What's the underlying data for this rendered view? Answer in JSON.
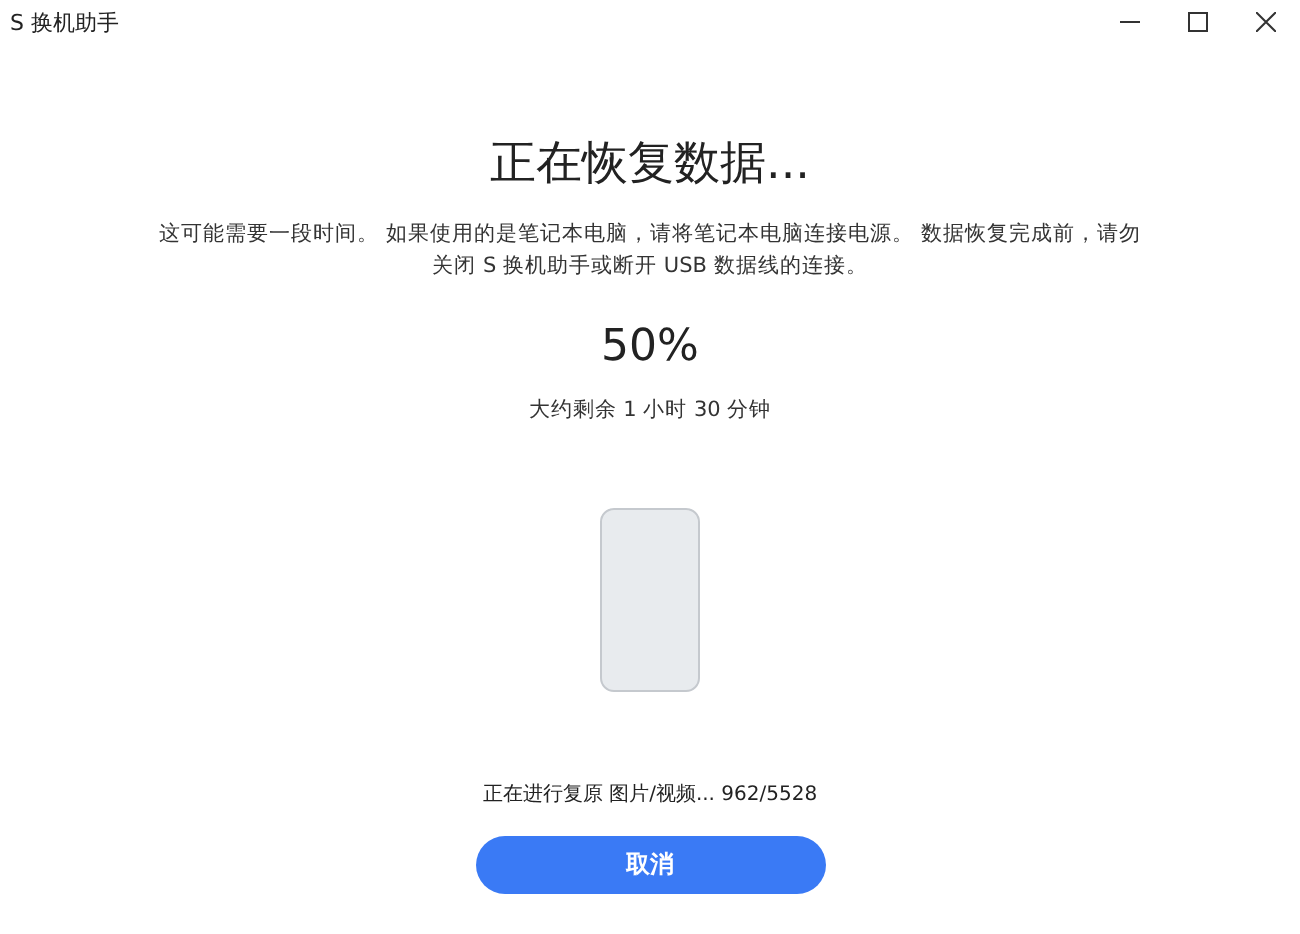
{
  "window": {
    "title": "S 换机助手"
  },
  "restore": {
    "heading": "正在恢复数据...",
    "description": "这可能需要一段时间。 如果使用的是笔记本电脑，请将笔记本电脑连接电源。 数据恢复完成前，请勿关闭 S 换机助手或断开 USB 数据线的连接。",
    "percent": "50%",
    "remaining": "大约剩余 1 小时 30 分钟",
    "status": "正在进行复原 图片/视频... 962/5528",
    "button": "取消"
  }
}
